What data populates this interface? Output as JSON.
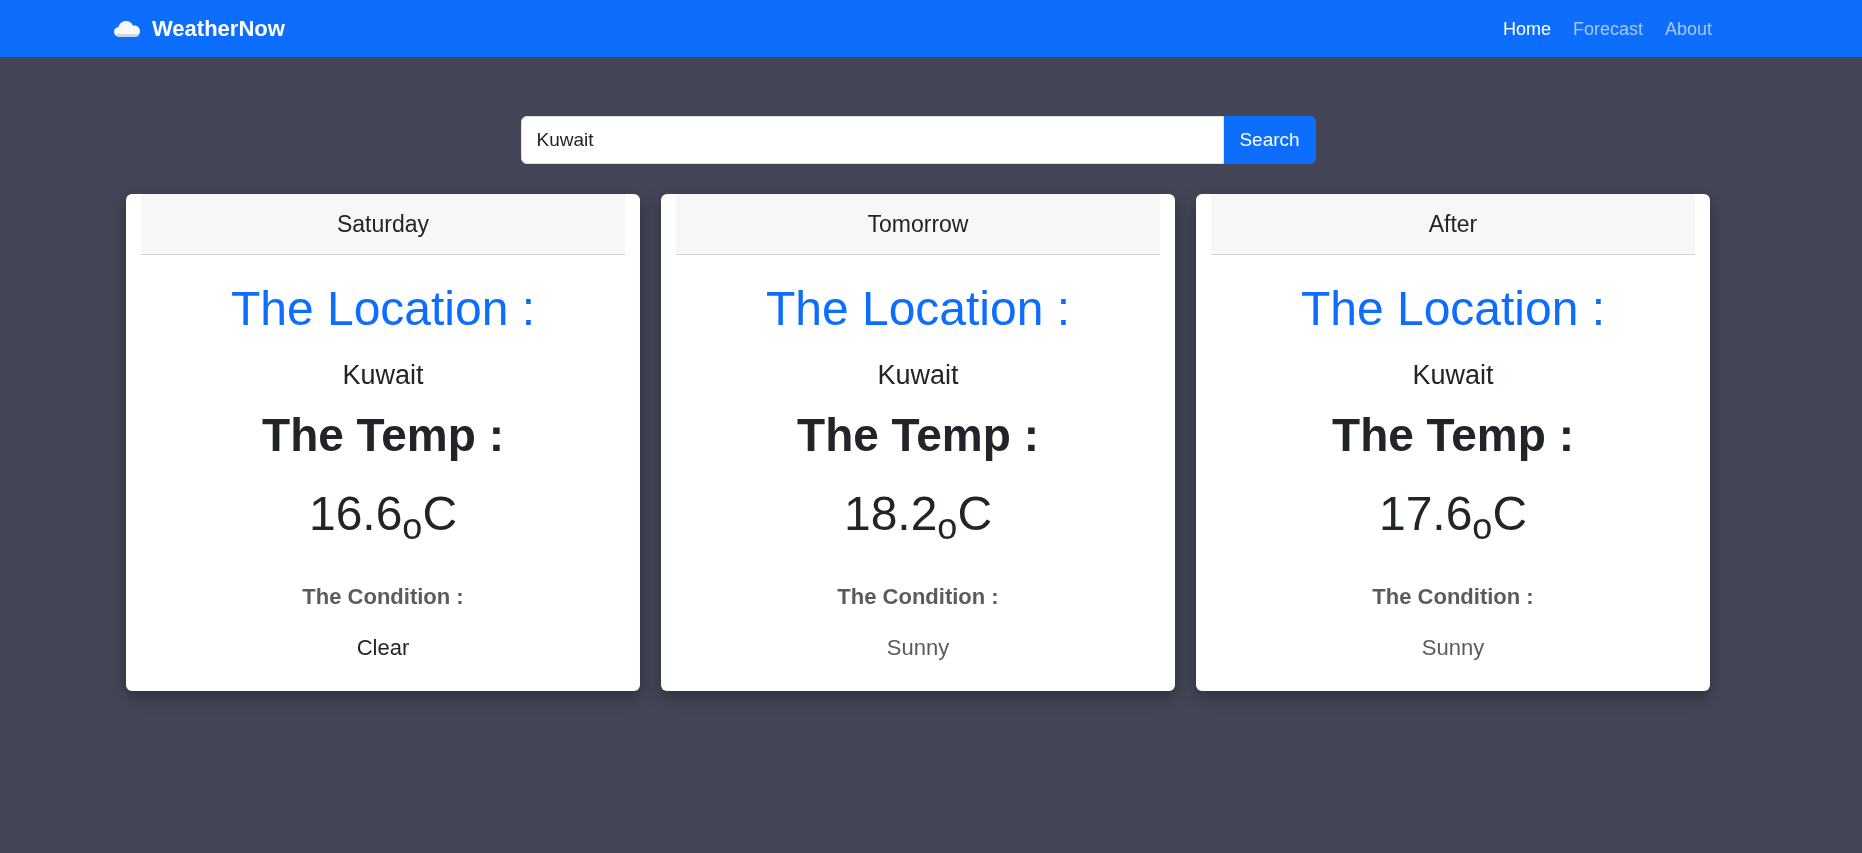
{
  "navbar": {
    "brand": "WeatherNow",
    "links": [
      {
        "label": "Home",
        "selected": true
      },
      {
        "label": "Forecast",
        "selected": false
      },
      {
        "label": "About",
        "selected": false
      }
    ]
  },
  "search": {
    "value": "Kuwait",
    "button": "Search"
  },
  "days": [
    {
      "day": "Saturday",
      "location_label": "The Location :",
      "location": "Kuwait",
      "temp_label": "The Temp :",
      "temp": "16.6$_{o}$C",
      "condition_label": "The Condition :",
      "condition": "Clear",
      "color": "#212529"
    },
    {
      "day": "Tomorrow",
      "location_label": "The Location :",
      "location": "Kuwait",
      "temp_label": "The Temp :",
      "temp": "18.2$_{o}$C",
      "condition_label": "The Condition :",
      "condition": "Sunny",
      "color": "#595c5f"
    },
    {
      "day": "After",
      "location_label": "The Location :",
      "location": "Kuwait",
      "temp_label": "The Temp :",
      "temp": "17.6$_{o}$C",
      "condition_label": "The Condition :",
      "condition": "Sunny",
      "color": "#595c5f"
    }
  ]
}
